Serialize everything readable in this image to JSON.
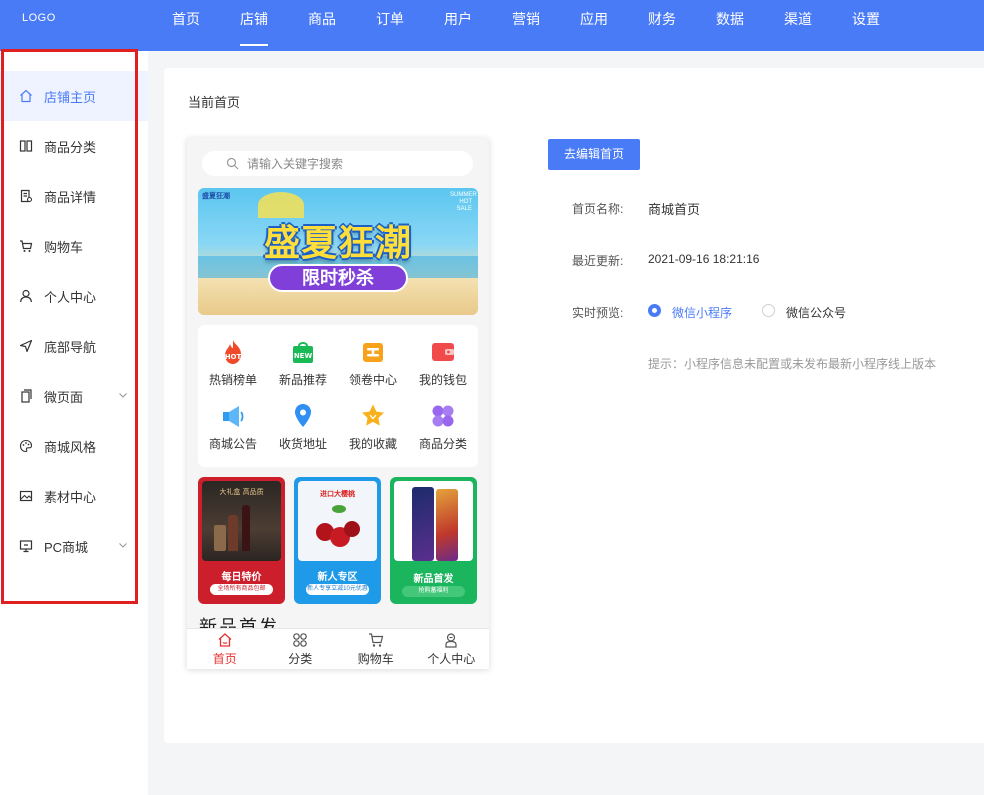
{
  "header": {
    "logo": "LOGO",
    "nav": [
      {
        "label": "首页",
        "active": false
      },
      {
        "label": "店铺",
        "active": true
      },
      {
        "label": "商品",
        "active": false
      },
      {
        "label": "订单",
        "active": false
      },
      {
        "label": "用户",
        "active": false
      },
      {
        "label": "营销",
        "active": false
      },
      {
        "label": "应用",
        "active": false
      },
      {
        "label": "财务",
        "active": false
      },
      {
        "label": "数据",
        "active": false
      },
      {
        "label": "渠道",
        "active": false
      },
      {
        "label": "设置",
        "active": false
      }
    ]
  },
  "sidebar": {
    "items": [
      {
        "label": "店铺主页",
        "icon": "home-icon",
        "active": true
      },
      {
        "label": "商品分类",
        "icon": "category-icon"
      },
      {
        "label": "商品详情",
        "icon": "detail-icon"
      },
      {
        "label": "购物车",
        "icon": "cart-icon"
      },
      {
        "label": "个人中心",
        "icon": "user-icon"
      },
      {
        "label": "底部导航",
        "icon": "navigation-icon"
      },
      {
        "label": "微页面",
        "icon": "page-icon",
        "expandable": true
      },
      {
        "label": "商城风格",
        "icon": "palette-icon"
      },
      {
        "label": "素材中心",
        "icon": "image-icon"
      },
      {
        "label": "PC商城",
        "icon": "monitor-icon",
        "expandable": true
      }
    ]
  },
  "main": {
    "title": "当前首页",
    "edit_button": "去编辑首页",
    "name_label": "首页名称:",
    "name_value": "商城首页",
    "update_label": "最近更新:",
    "update_value": "2021-09-16 18:21:16",
    "preview_label": "实时预览:",
    "preview_options": [
      {
        "label": "微信小程序",
        "checked": true
      },
      {
        "label": "微信公众号",
        "checked": false
      }
    ],
    "tip": "提示：小程序信息未配置或未发布最新小程序线上版本"
  },
  "phone": {
    "search_placeholder": "请输入关键字搜索",
    "banner": {
      "title": "盛夏狂潮",
      "subtitle": "限时秒杀",
      "top_left": "盛夏狂潮",
      "top_right": "SUMMER HOT SALE"
    },
    "grid": [
      {
        "label": "热销榜单",
        "icon": "hot-icon",
        "color": "#f04a2a",
        "badge": "HOT"
      },
      {
        "label": "新品推荐",
        "icon": "new-bag-icon",
        "color": "#19b955",
        "badge": "NEW"
      },
      {
        "label": "领卷中心",
        "icon": "coupon-icon",
        "color": "#f8a11a"
      },
      {
        "label": "我的钱包",
        "icon": "wallet-icon",
        "color": "#f04a4a"
      },
      {
        "label": "商城公告",
        "icon": "megaphone-icon",
        "color": "#2f9cf2"
      },
      {
        "label": "收货地址",
        "icon": "location-pin-icon",
        "color": "#2f8ff2"
      },
      {
        "label": "我的收藏",
        "icon": "star-icon",
        "color": "#f8b11a"
      },
      {
        "label": "商品分类",
        "icon": "four-petal-icon",
        "color": "#9966ee"
      }
    ],
    "promos": [
      {
        "title": "每日特价",
        "tag": "全场所有商品包邮",
        "img_text": "大礼盒 高品质",
        "color": "#cc1f2b",
        "tag_bg": "#ffffff",
        "tag_color": "#cc1f2b"
      },
      {
        "title": "新人专区",
        "tag": "新人专享立减10元优惠",
        "img_text": "进口大樱桃",
        "color": "#1f9ae8",
        "tag_bg": "#ffffff",
        "tag_color": "#1f7dd1"
      },
      {
        "title": "新品首发",
        "tag": "抢购蓄福利",
        "img_text": "",
        "color": "#1bb55e",
        "tag_bg": "#43c779",
        "tag_color": "#ffffff"
      }
    ],
    "partial_heading": "新品首发",
    "tabs": [
      {
        "label": "首页",
        "icon": "home-tab-icon",
        "active": true
      },
      {
        "label": "分类",
        "icon": "grid-tab-icon",
        "active": false
      },
      {
        "label": "购物车",
        "icon": "cart-tab-icon",
        "active": false
      },
      {
        "label": "个人中心",
        "icon": "user-tab-icon",
        "active": false
      }
    ]
  },
  "colors": {
    "primary": "#4a7bf7",
    "highlight_border": "#e02020",
    "active_tab": "#e53232"
  }
}
